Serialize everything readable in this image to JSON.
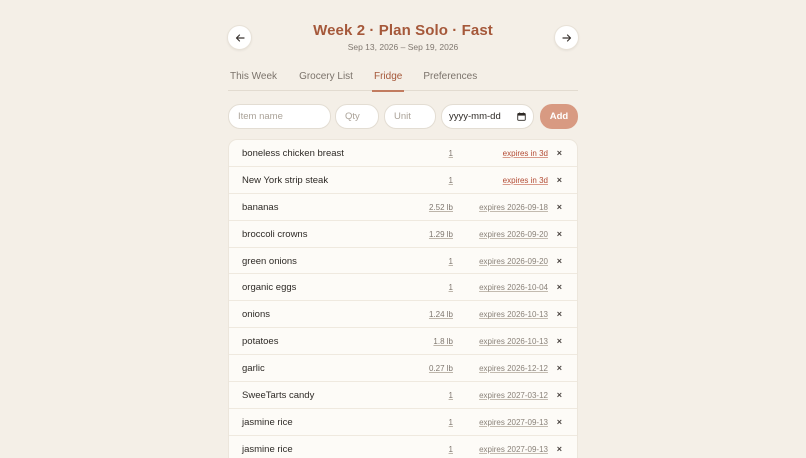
{
  "header": {
    "title": "Week 2 · Plan Solo · Fast",
    "date_range": "Sep 13, 2026 – Sep 19, 2026",
    "prev_icon": "arrow-left-icon",
    "next_icon": "arrow-right-icon"
  },
  "tabs": [
    {
      "label": "This Week",
      "active": false
    },
    {
      "label": "Grocery List",
      "active": false
    },
    {
      "label": "Fridge",
      "active": true
    },
    {
      "label": "Preferences",
      "active": false
    }
  ],
  "form": {
    "name_placeholder": "Item name",
    "qty_placeholder": "Qty",
    "unit_placeholder": "Unit",
    "date_placeholder": "yyyy-mm-dd",
    "add_label": "Add"
  },
  "colors": {
    "accent": "#a5583a",
    "add_button": "#d89a82",
    "expiring_soon": "#b24a33"
  },
  "items": [
    {
      "name": "boneless chicken breast",
      "qty": "1",
      "expiry": "expires in 3d",
      "soon": true
    },
    {
      "name": "New York strip steak",
      "qty": "1",
      "expiry": "expires in 3d",
      "soon": true
    },
    {
      "name": "bananas",
      "qty": "2.52 lb",
      "expiry": "expires 2026-09-18",
      "soon": false
    },
    {
      "name": "broccoli crowns",
      "qty": "1.29 lb",
      "expiry": "expires 2026-09-20",
      "soon": false
    },
    {
      "name": "green onions",
      "qty": "1",
      "expiry": "expires 2026-09-20",
      "soon": false
    },
    {
      "name": "organic eggs",
      "qty": "1",
      "expiry": "expires 2026-10-04",
      "soon": false
    },
    {
      "name": "onions",
      "qty": "1.24 lb",
      "expiry": "expires 2026-10-13",
      "soon": false
    },
    {
      "name": "potatoes",
      "qty": "1.8 lb",
      "expiry": "expires 2026-10-13",
      "soon": false
    },
    {
      "name": "garlic",
      "qty": "0.27 lb",
      "expiry": "expires 2026-12-12",
      "soon": false
    },
    {
      "name": "SweeTarts candy",
      "qty": "1",
      "expiry": "expires 2027-03-12",
      "soon": false
    },
    {
      "name": "jasmine rice",
      "qty": "1",
      "expiry": "expires 2027-09-13",
      "soon": false
    },
    {
      "name": "jasmine rice",
      "qty": "1",
      "expiry": "expires 2027-09-13",
      "soon": false
    }
  ],
  "delete_glyph": "×"
}
